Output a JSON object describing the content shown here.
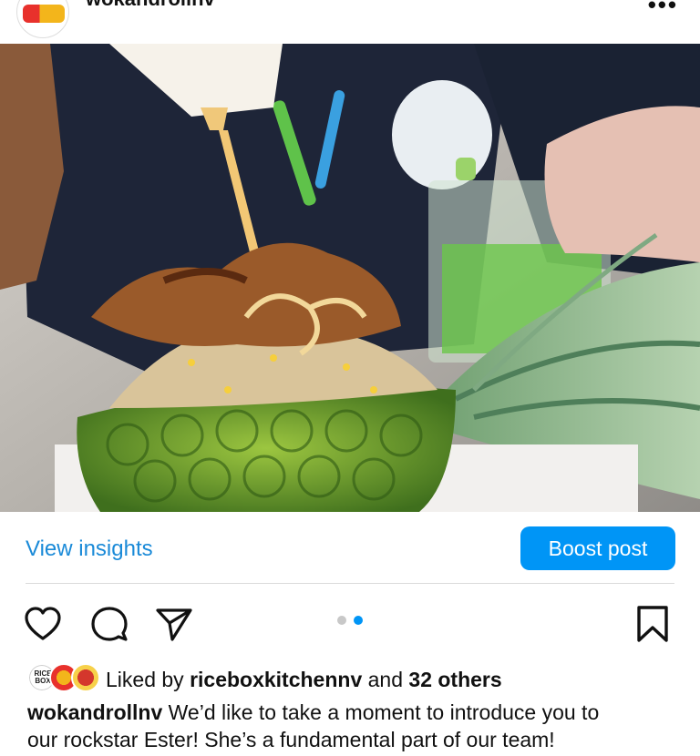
{
  "header": {
    "username": "wokandrollnv",
    "more_label": "•••"
  },
  "post": {
    "image_alt": "Pineapple fried rice bowl with fried chicken and sauce drizzle",
    "carousel": {
      "count": 2,
      "active_index": 1
    }
  },
  "insights": {
    "view_label": "View insights",
    "boost_label": "Boost post"
  },
  "actions": {
    "like_icon": "heart-icon",
    "comment_icon": "comment-icon",
    "share_icon": "paper-plane-icon",
    "save_icon": "bookmark-icon"
  },
  "likes": {
    "prefix": "Liked by ",
    "user": "riceboxkitchennv",
    "middle": " and ",
    "others": "32 others",
    "avatar1_text": "RICE BOX"
  },
  "caption": {
    "author": "wokandrollnv",
    "line1": " We’d like to take a moment to introduce you to",
    "line2": "our rockstar Ester! She’s a fundamental part of our team!"
  },
  "colors": {
    "accent": "#0095f6",
    "link": "#1a8ad8",
    "divider": "#dbdbdb"
  }
}
